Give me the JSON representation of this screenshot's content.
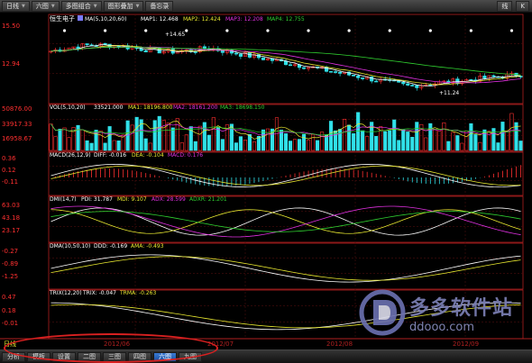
{
  "toolbar": {
    "period": "日线",
    "layout": "六图",
    "multi": "多图组合",
    "overlay": "图形叠加",
    "memo": "备忘录",
    "right1": "线",
    "right2": "K"
  },
  "main_panel": {
    "stock": "恒生电子",
    "ma_label": "MA(5,10,20,60)",
    "map1": "MAP1: 12.468",
    "map2": "MAP2: 12.424",
    "map3": "MAP3: 12.208",
    "map4": "MAP4: 12.755",
    "y_top": "15.50",
    "y_mid": "12.94",
    "high_note": "+14.65",
    "low_note": "+11.24"
  },
  "vol_panel": {
    "label": "VOL(5,10,20)",
    "vol": "33521.000",
    "ma1": "MA1: 18196.800",
    "ma2": "MA2: 18161.200",
    "ma3": "MA3: 18698.150",
    "y1": "50876.00",
    "y2": "33917.33",
    "y3": "16958.67"
  },
  "macd_panel": {
    "label": "MACD(26,12,9)",
    "diff": "DIFF: -0.016",
    "dea": "DEA: -0.104",
    "macd": "MACD: 0.176",
    "y1": "0.36",
    "y2": "0.12",
    "y3": "-0.11"
  },
  "dmi_panel": {
    "label": "DMI(14,7)",
    "pdi": "PDI: 31.787",
    "mdi": "MDI: 9.107",
    "adx": "ADX: 28.599",
    "adxr": "ADXR: 21.201",
    "y1": "63.03",
    "y2": "43.18",
    "y3": "23.17"
  },
  "dma_panel": {
    "label": "DMA(10,50,10)",
    "ddd": "DDD: -0.169",
    "ama": "AMA: -0.493",
    "y1": "-0.27",
    "y2": "-0.89",
    "y3": "-1.25"
  },
  "trix_panel": {
    "label": "TRIX(12,20)",
    "trix": "TRIX: -0.047",
    "trma": "TRMA: -0.263",
    "y1": "0.47",
    "y2": "0.18",
    "y3": "-0.01"
  },
  "xaxis": {
    "period_label": "日线",
    "m1": "2012/06",
    "m2": "2012/07",
    "m3": "2012/08",
    "m4": "2012/09"
  },
  "bottom_tabs": [
    "分析",
    "模板",
    "设置",
    "二图",
    "三图",
    "四图",
    "六图",
    "九图"
  ],
  "active_tab": "六图",
  "watermark": {
    "cn": "多多软件站",
    "url": "ddooo.com"
  },
  "colors": {
    "up": "#ff3030",
    "down": "#30e0e8",
    "ma1": "#ffffff",
    "ma2": "#e8e830",
    "ma3": "#e030e0",
    "ma4": "#30d030",
    "axis": "#b02020"
  }
}
